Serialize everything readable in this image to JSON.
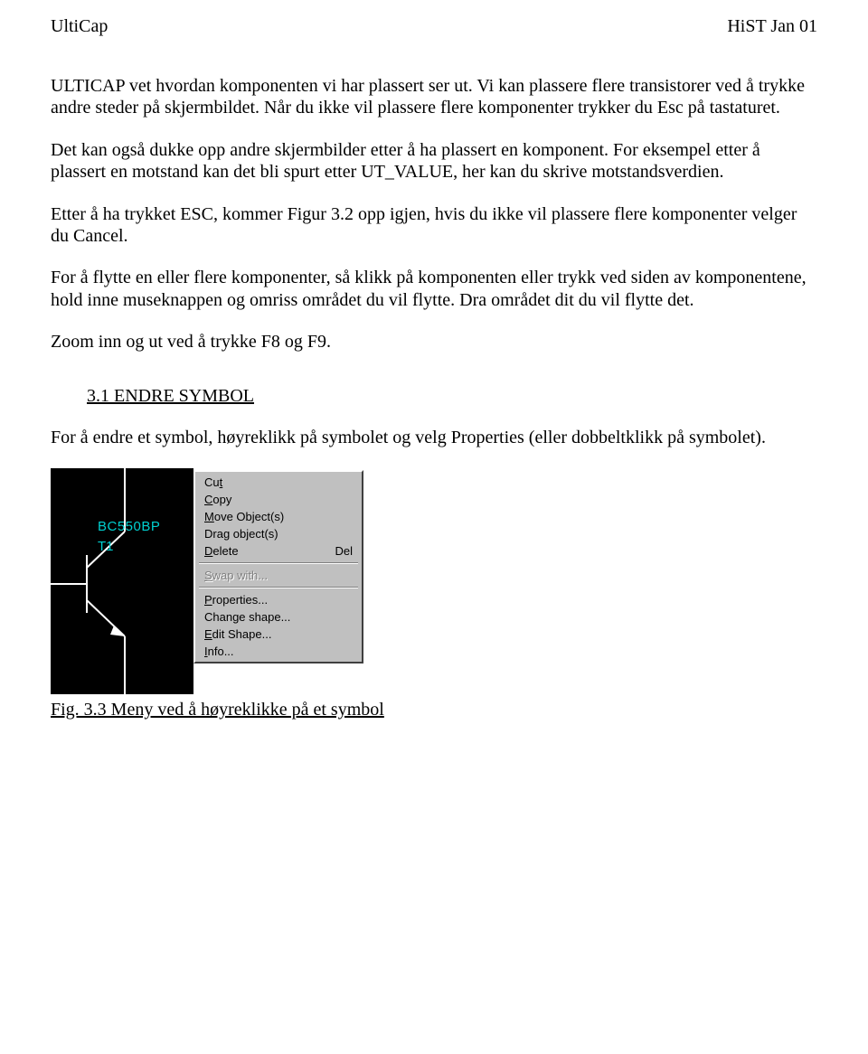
{
  "header": {
    "left": "UltiCap",
    "right": "HiST Jan 01"
  },
  "paragraphs": {
    "p1": "ULTICAP vet hvordan komponenten vi har plassert ser ut. Vi kan plassere flere transistorer ved å trykke andre steder på skjermbildet. Når du ikke vil plassere flere komponenter trykker du Esc på tastaturet.",
    "p2": "Det kan også dukke opp andre skjermbilder etter å ha plassert en komponent. For eksempel etter å plassert en motstand kan det bli spurt etter UT_VALUE, her kan du skrive motstandsverdien.",
    "p3": "Etter å ha trykket ESC, kommer Figur 3.2 opp igjen, hvis du ikke vil plassere flere komponenter velger du Cancel.",
    "p4": "For å flytte en eller flere komponenter, så klikk på komponenten eller trykk ved siden av komponentene, hold inne museknappen og omriss området du vil flytte. Dra området dit du vil flytte det.",
    "p5": "Zoom inn og ut ved å trykke F8 og F9.",
    "p6": "For å endre et symbol, høyreklikk på symbolet og velg Properties (eller dobbeltklikk på symbolet)."
  },
  "section": {
    "heading": "3.1 ENDRE SYMBOL"
  },
  "embed": {
    "schematic": {
      "part": "BC550BP",
      "ref": "T1"
    },
    "context_menu": {
      "items": [
        {
          "mn": "t",
          "post": "",
          "pre": "Cu",
          "shortcut": "",
          "disabled": false
        },
        {
          "mn": "C",
          "post": "opy",
          "pre": "",
          "shortcut": "",
          "disabled": false
        },
        {
          "mn": "M",
          "post": "ove Object(s)",
          "pre": "",
          "shortcut": "",
          "disabled": false
        },
        {
          "mn": "",
          "post": "",
          "pre": "Drag object(s)",
          "shortcut": "",
          "disabled": false
        },
        {
          "mn": "D",
          "post": "elete",
          "pre": "",
          "shortcut": "Del",
          "disabled": false
        },
        {
          "type": "sep"
        },
        {
          "mn": "S",
          "post": "wap with...",
          "pre": "",
          "shortcut": "",
          "disabled": true
        },
        {
          "type": "sep"
        },
        {
          "mn": "P",
          "post": "roperties...",
          "pre": "",
          "shortcut": "",
          "disabled": false
        },
        {
          "mn": "",
          "post": "",
          "pre": "Change shape...",
          "shortcut": "",
          "disabled": false
        },
        {
          "mn": "E",
          "post": "dit Shape...",
          "pre": "",
          "shortcut": "",
          "disabled": false
        },
        {
          "mn": "I",
          "post": "nfo...",
          "pre": "",
          "shortcut": "",
          "disabled": false
        }
      ]
    },
    "caption": "Fig. 3.3 Meny ved å høyreklikke på et symbol"
  }
}
